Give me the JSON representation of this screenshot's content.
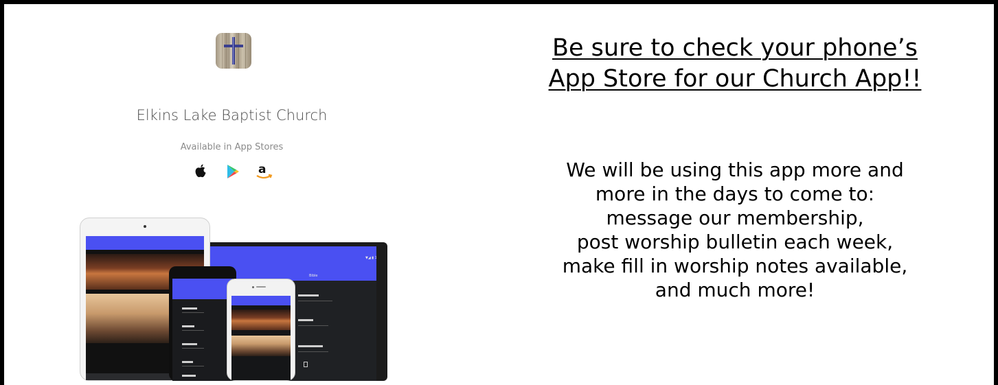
{
  "app_card": {
    "name": "Elkins Lake Baptist Church",
    "availability": "Available in App Stores",
    "stores": [
      "apple-icon",
      "google-play-icon",
      "amazon-icon"
    ]
  },
  "promo": {
    "headline_lines": [
      "Be sure to check your phone’s",
      "App Store for our Church App!!"
    ],
    "body_lines": [
      "We will be using this app more and",
      "more in the days to come to:",
      "message our membership,",
      "post worship bulletin each week,",
      "make fill in worship notes available,",
      "and much more!"
    ]
  },
  "colors": {
    "app_accent": "#4a50f2",
    "text": "#000000",
    "app_name_text": "#4a4a4a",
    "frame": "#000000"
  }
}
